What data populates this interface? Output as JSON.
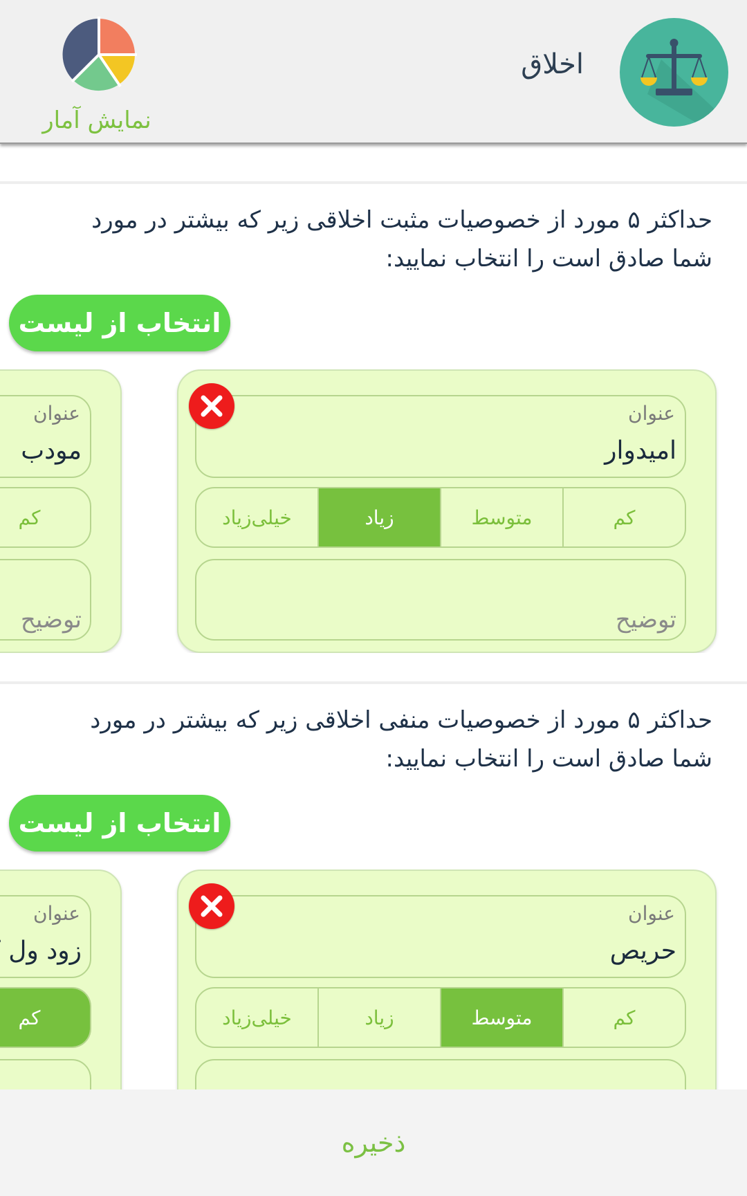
{
  "header": {
    "title": "اخلاق",
    "app_icon": "scales-icon",
    "stats_label": "نمایش آمار",
    "stats_icon": "pie-chart-icon"
  },
  "common": {
    "pick_button_label": "انتخاب از لیست",
    "title_field_label": "عنوان",
    "description_placeholder": "توضیح",
    "levels": [
      "کم",
      "متوسط",
      "زیاد",
      "خیلی‌زیاد"
    ]
  },
  "positive": {
    "instruction": "حداکثر ۵ مورد از خصوصیات مثبت اخلاقی زیر که بیشتر در مورد شما صادق است را انتخاب نمایید:",
    "card_main": {
      "title": "امیدوار",
      "selected_level": "زیاد"
    },
    "card_side": {
      "title": "مودب",
      "selected_level": ""
    }
  },
  "negative": {
    "instruction": "حداکثر ۵ مورد از خصوصیات منفی اخلاقی زیر که بیشتر در مورد شما صادق است را انتخاب نمایید:",
    "card_main": {
      "title": "حریص",
      "selected_level": "متوسط"
    },
    "card_side": {
      "title": "زود ول کن",
      "selected_level": "کم"
    }
  },
  "footer": {
    "save_label": "ذخیره"
  },
  "colors": {
    "accent_green": "#5bd84b",
    "selected_level": "#77c13e",
    "card_bg": "#eafcc8",
    "remove_red": "#ee1c1c",
    "app_icon_bg": "#48b59c"
  }
}
